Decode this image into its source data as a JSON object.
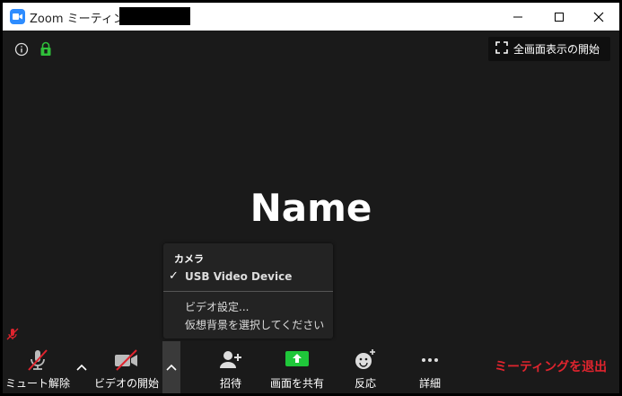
{
  "window": {
    "title": "Zoom ミーティング ID:"
  },
  "video": {
    "participant_name": "Name",
    "fullscreen_label": "全画面表示の開始"
  },
  "camera_menu": {
    "header": "カメラ",
    "devices": [
      "USB Video Device"
    ],
    "selected_device": "USB Video Device",
    "video_settings": "ビデオ設定...",
    "virtual_background": "仮想背景を選択してください"
  },
  "toolbar": {
    "unmute": "ミュート解除",
    "start_video": "ビデオの開始",
    "invite": "招待",
    "share_screen": "画面を共有",
    "reactions": "反応",
    "more": "詳細",
    "leave": "ミーティングを退出"
  },
  "colors": {
    "accent": "#2d8cff",
    "share_green": "#1fc73a",
    "leave_red": "#e0242e",
    "mute_red": "#e0242e",
    "background": "#1a1a1a"
  }
}
